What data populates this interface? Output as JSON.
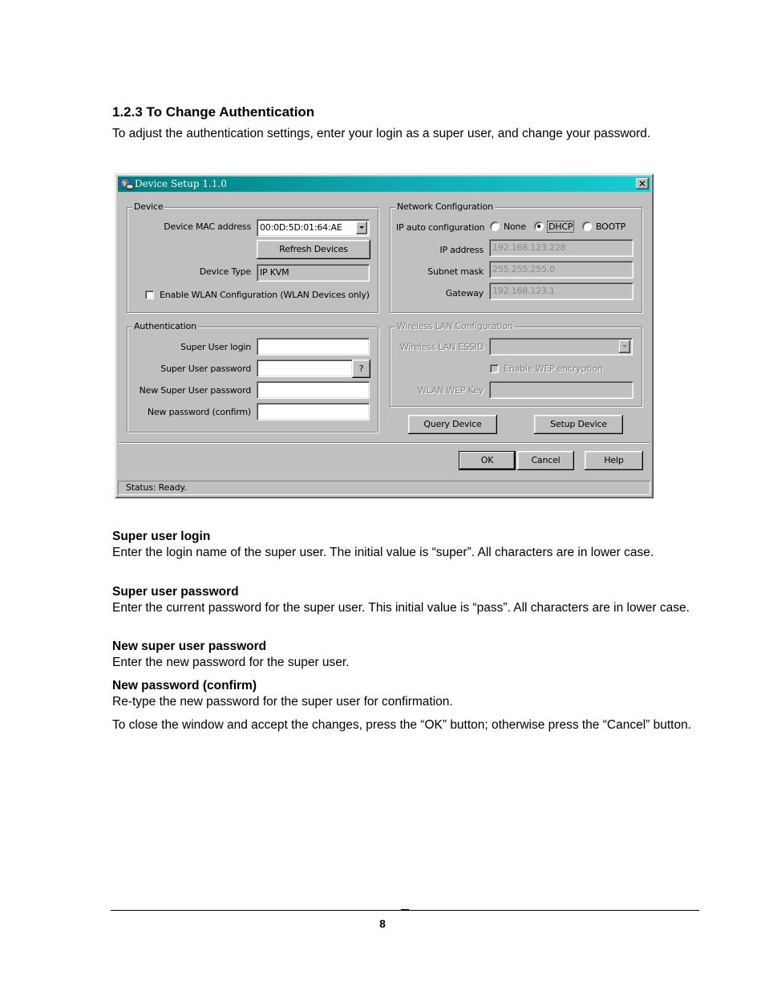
{
  "document": {
    "heading": "1.2.3 To Change Authentication",
    "intro": "To adjust the authentication settings, enter your login as a super user, and change your password.",
    "page_number": "8"
  },
  "dialog": {
    "title": "Device Setup 1.1.0",
    "title_icon": "network-computer-icon",
    "close_icon": "close-icon",
    "title_bar_colors": [
      "#007a7a",
      "#18ccd4"
    ],
    "device_group": {
      "label": "Device",
      "mac_label": "Device MAC address",
      "mac_value": "00:0D:5D:01:64:AE",
      "refresh_button": "Refresh Devices",
      "type_label": "Device Type",
      "type_value": "IP KVM",
      "wlan_checkbox_label": "Enable WLAN Configuration (WLAN Devices only)",
      "wlan_checked": false
    },
    "network_group": {
      "label": "Network Configuration",
      "auto_config_label": "IP auto configuration",
      "options": [
        "None",
        "DHCP",
        "BOOTP"
      ],
      "selected": "DHCP",
      "ip_label": "IP address",
      "ip_value": "192.168.123.228",
      "subnet_label": "Subnet mask",
      "subnet_value": "255.255.255.0",
      "gateway_label": "Gateway",
      "gateway_value": "192.168.123.1"
    },
    "auth_group": {
      "label": "Authentication",
      "login_label": "Super User login",
      "login_value": "",
      "password_label": "Super User password",
      "password_value": "",
      "password_help_button": "?",
      "new_password_label": "New Super User password",
      "new_password_value": "",
      "confirm_label": "New password (confirm)",
      "confirm_value": ""
    },
    "wireless_group": {
      "label": "Wireless LAN Configuration",
      "essid_label": "Wireless LAN ESSID",
      "essid_value": "",
      "wep_checkbox_label": "Enable WEP encryption",
      "wep_checked": false,
      "wep_key_label": "WLAN WEP Key",
      "wep_key_value": ""
    },
    "query_button": "Query Device",
    "setup_button": "Setup Device",
    "ok_button": "OK",
    "cancel_button": "Cancel",
    "help_button": "Help",
    "status": "Status: Ready."
  },
  "descriptions": [
    {
      "title": "Super user login",
      "text": "Enter the login name of the super user. The initial value is “super”. All characters are in lower case."
    },
    {
      "title": "Super user password",
      "text": "Enter the current password for the super user. This initial value is “pass”. All characters are in lower case."
    },
    {
      "title": "New super user password",
      "text": "Enter the new password for the super user."
    },
    {
      "title": "New password (confirm)",
      "text": "Re-type the new password for the super user for confirmation."
    }
  ],
  "closing_note": "To close the window and accept the changes, press the “OK” button; otherwise press the “Cancel” button."
}
